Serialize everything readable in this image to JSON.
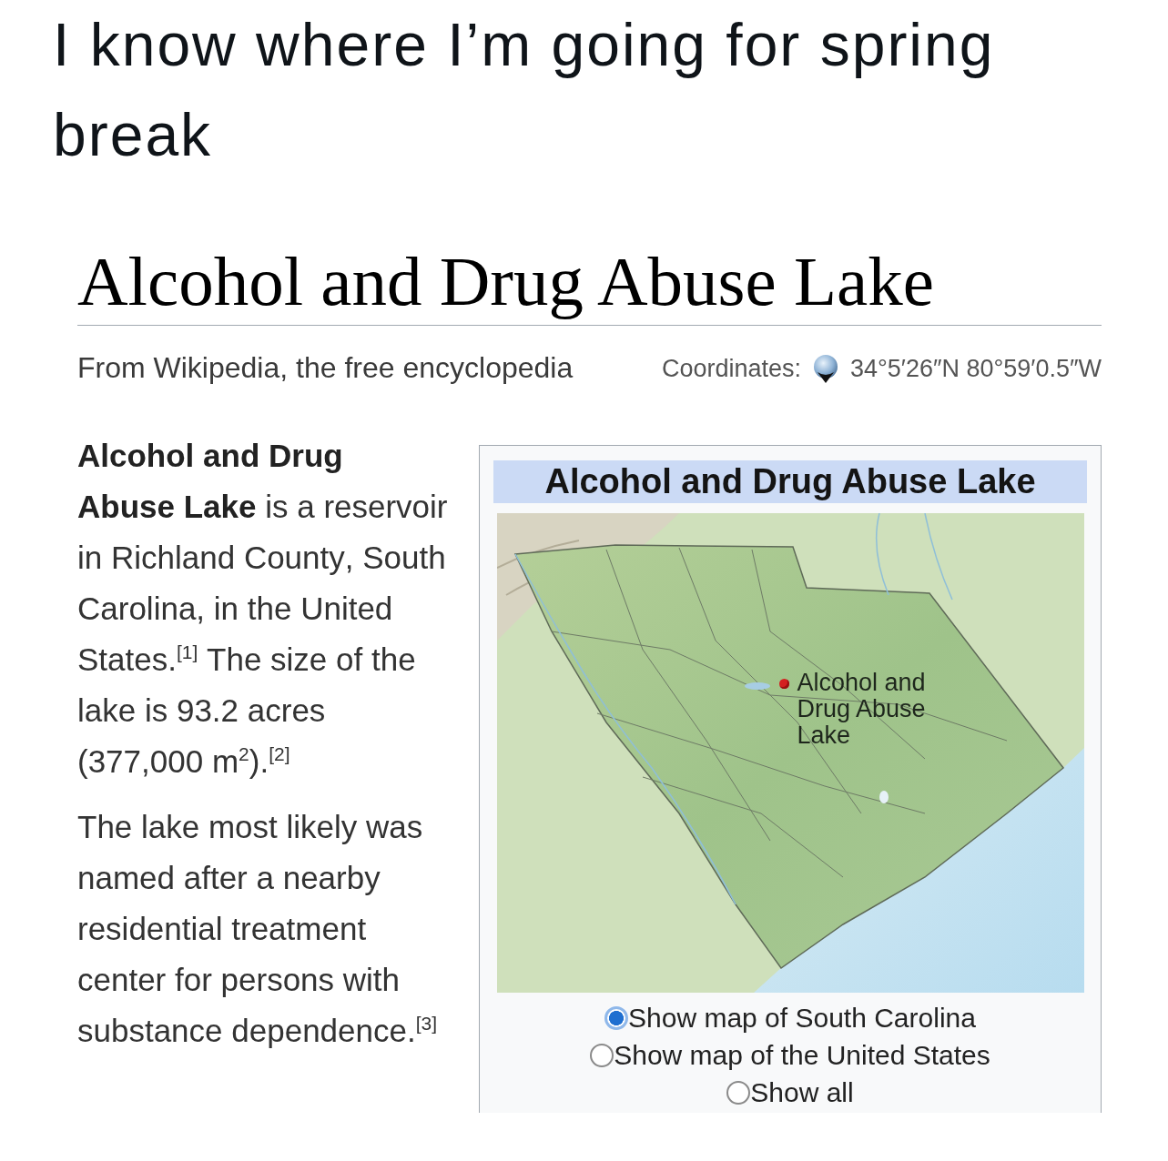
{
  "post": {
    "text": "I know where I’m going for spring break"
  },
  "article": {
    "title": "Alcohol and Drug Abuse Lake",
    "tagline": "From Wikipedia, the free encyclopedia",
    "coordinates": {
      "label": "Coordinates:",
      "value": "34°5′26″N 80°59′0.5″W"
    },
    "paragraphs": [
      "**Alcohol and Drug Abuse Lake** is a reservoir in Richland County, South Carolina, in the United States.$^{[1]}$ The size of the lake is 93.2 acres (377,000 m$^{2}$).$^{[2]}$",
      "The lake most likely was named after a nearby residential treatment center for persons with substance dependence.$^{[3]}$"
    ]
  },
  "infobox": {
    "caption": "Alcohol and Drug Abuse Lake",
    "map": {
      "marker_label": "Alcohol and Drug Abuse Lake"
    },
    "map_options": [
      {
        "label": "Show map of South Carolina",
        "selected": true
      },
      {
        "label": "Show map of the United States",
        "selected": false
      },
      {
        "label": "Show all",
        "selected": false
      }
    ]
  }
}
